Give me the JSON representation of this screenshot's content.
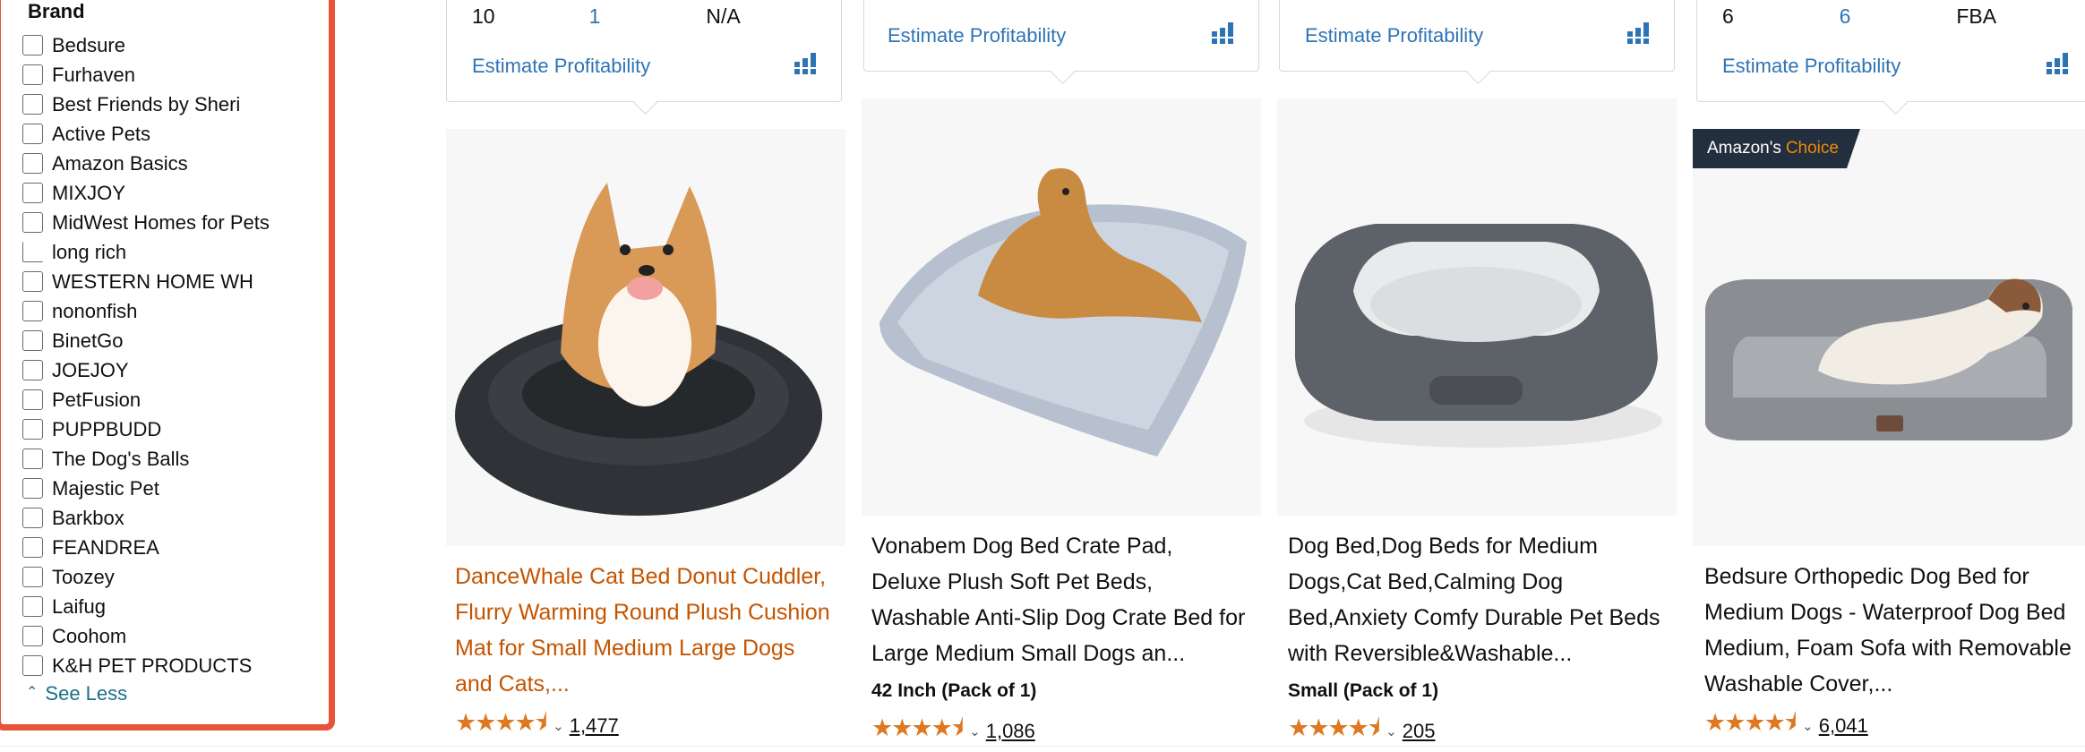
{
  "brand_filter": {
    "heading": "Brand",
    "items": [
      "Bedsure",
      "Furhaven",
      "Best Friends by Sheri",
      "Active Pets",
      "Amazon Basics",
      "MIXJOY",
      "MidWest Homes for Pets",
      "long rich",
      "WESTERN HOME WH",
      "nononfish",
      "BinetGo",
      "JOEJOY",
      "PetFusion",
      "PUPPBUDD",
      "The Dog's Balls",
      "Majestic Pet",
      "Barkbox",
      "FEANDREA",
      "Toozey",
      "Laifug",
      "Coohom",
      "K&H PET PRODUCTS"
    ],
    "see_less": "See Less"
  },
  "products": [
    {
      "stats": [
        "10",
        "1",
        "N/A"
      ],
      "estimate_label": "Estimate Profitability",
      "title": "DanceWhale Cat Bed Donut Cuddler, Flurry Warming Round Plush Cushion Mat for Small Medium Large Dogs and Cats,...",
      "size": "",
      "rating": 4.5,
      "reviews": "1,477",
      "image": "gray-donut-bed-with-corgi"
    },
    {
      "stats": [],
      "estimate_label": "Estimate Profitability",
      "title": "Vonabem Dog Bed Crate Pad, Deluxe Plush Soft Pet Beds, Washable Anti-Slip Dog Crate Bed for Large Medium Small Dogs an...",
      "size": "42 Inch (Pack of 1)",
      "rating": 4.5,
      "reviews": "1,086",
      "image": "fluffy-crate-pad-with-golden-retriever"
    },
    {
      "stats": [],
      "estimate_label": "Estimate Profitability",
      "title": "Dog Bed,Dog Beds for Medium Dogs,Cat Bed,Calming Dog Bed,Anxiety Comfy Durable Pet Beds with Reversible&Washable...",
      "size": "Small (Pack of 1)",
      "rating": 4.5,
      "reviews": "205",
      "image": "gray-rectangular-bolster-bed"
    },
    {
      "stats": [
        "6",
        "6",
        "FBA"
      ],
      "estimate_label": "Estimate Profitability",
      "badge": {
        "prefix": "Amazon's",
        "highlight": "Choice"
      },
      "title": "Bedsure Orthopedic Dog Bed for Medium Dogs - Waterproof Dog Bed Medium, Foam Sofa with Removable Washable Cover,...",
      "size": "",
      "rating": 4.5,
      "reviews": "6,041",
      "image": "orthopedic-sofa-bed-with-puppy"
    }
  ],
  "colors": {
    "accent_link": "#2e74b5",
    "star": "#de7921",
    "sponsored_title": "#c45500",
    "panel_border": "#e8533a"
  }
}
